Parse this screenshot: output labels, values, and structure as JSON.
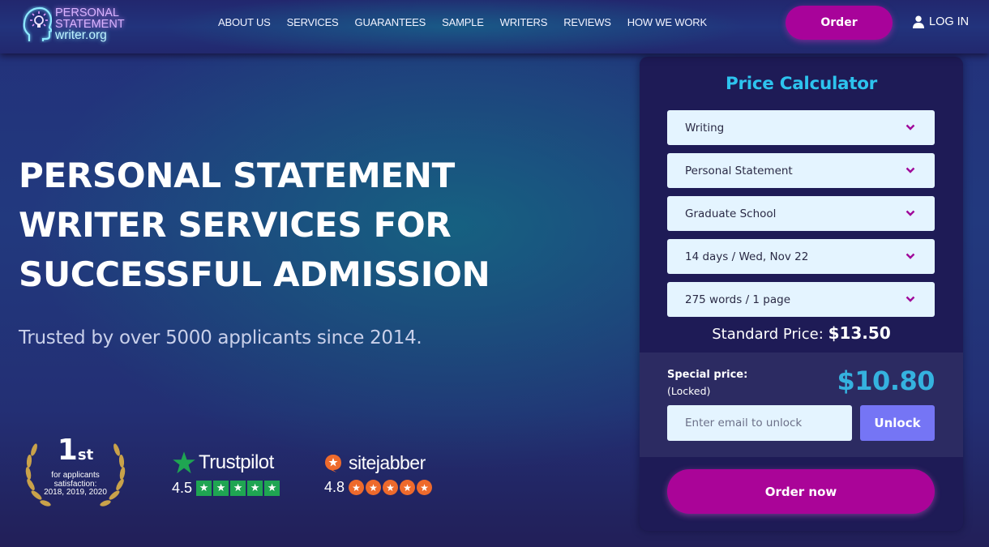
{
  "header": {
    "logo": {
      "line1": "PERSONAL",
      "line2": "STATEMENT",
      "line3": "writer.org",
      "icon": "head-lightbulb-icon"
    },
    "nav": [
      "ABOUT US",
      "SERVICES",
      "GUARANTEES",
      "SAMPLE",
      "WRITERS",
      "REVIEWS",
      "HOW WE WORK"
    ],
    "order_label": "Order",
    "login_label": "LOG IN",
    "login_icon": "user-icon"
  },
  "hero": {
    "title_lines": [
      "PERSONAL STATEMENT",
      "WRITER SERVICES FOR",
      "SUCCESSFUL ADMISSION"
    ],
    "subtitle": "Trusted by over 5000 applicants since 2014."
  },
  "badges": {
    "award": {
      "rank": "1",
      "suffix": "st",
      "line1": "for applicants",
      "line2": "satisfaction:",
      "line3": "2018, 2019, 2020",
      "icon": "laurel-wreath-icon"
    },
    "trustpilot": {
      "name": "Trustpilot",
      "score": "4.5",
      "stars": 5,
      "color": "#1fa552"
    },
    "sitejabber": {
      "name": "sitejabber",
      "score": "4.8",
      "stars": 5,
      "color": "#ee6a2c"
    }
  },
  "calculator": {
    "title": "Price Calculator",
    "selects": [
      {
        "name": "service-type-select",
        "value": "Writing"
      },
      {
        "name": "paper-type-select",
        "value": "Personal Statement"
      },
      {
        "name": "academic-level-select",
        "value": "Graduate School"
      },
      {
        "name": "deadline-select",
        "value": "14 days / Wed, Nov 22"
      },
      {
        "name": "pages-select",
        "value": "275 words / 1 page"
      }
    ],
    "standard_label": "Standard Price:",
    "standard_price": "$13.50",
    "special_label": "Special price:",
    "special_status": "(Locked)",
    "special_price": "$10.80",
    "email_placeholder": "Enter email to unlock",
    "email_value": "",
    "unlock_label": "Unlock",
    "order_now_label": "Order now"
  },
  "colors": {
    "accent_magenta": "#a8039a",
    "calc_title": "#2dc3ee",
    "special_price": "#35b2df",
    "unlock": "#7575f5",
    "chevron": "#a0089a"
  }
}
